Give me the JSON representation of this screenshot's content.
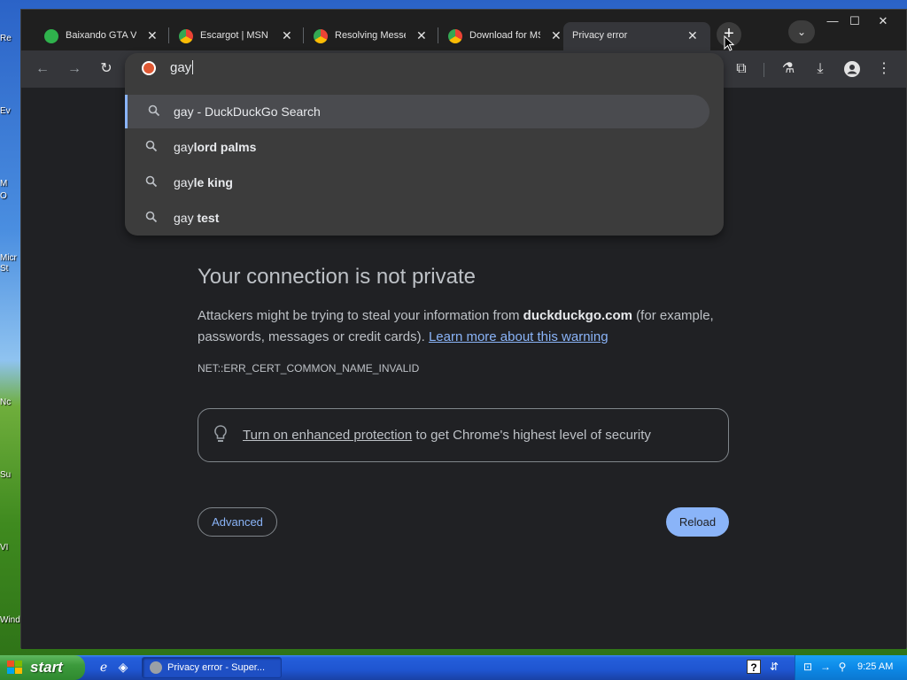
{
  "desktop": {
    "icon_labels": [
      "Re",
      "Ev",
      "M",
      "O",
      "Micr",
      "St",
      "Nc",
      "Su",
      "VI",
      "Wind"
    ]
  },
  "tabs": [
    {
      "title": "Baixando GTA V",
      "favicon": "green-app-icon",
      "favicon_color": "#2fb24c"
    },
    {
      "title": "Escargot | MSN M",
      "favicon": "chrome-icon",
      "favicon_color": "#f4b400"
    },
    {
      "title": "Resolving Messe",
      "favicon": "chrome-icon",
      "favicon_color": "#f4b400"
    },
    {
      "title": "Download for MS",
      "favicon": "chrome-icon",
      "favicon_color": "#f4b400"
    },
    {
      "title": "Privacy error",
      "favicon": "none",
      "active": true
    }
  ],
  "omnibox": {
    "typed": "gay",
    "suggestions": [
      {
        "prefix": "gay",
        "suffix": " - DuckDuckGo Search",
        "bold": false,
        "selected": true
      },
      {
        "prefix": "gay",
        "suffix": "lord palms",
        "bold": true,
        "selected": false
      },
      {
        "prefix": "gay",
        "suffix": "le king",
        "bold": true,
        "selected": false
      },
      {
        "prefix": "gay ",
        "suffix": "test",
        "bold": true,
        "selected": false
      }
    ]
  },
  "error_page": {
    "title": "Your connection is not private",
    "body_pre": "Attackers might be trying to steal your information from ",
    "domain": "duckduckgo.com",
    "body_post": " (for example, passwords, messages or credit cards). ",
    "learn_more": "Learn more about this warning",
    "error_code": "NET::ERR_CERT_COMMON_NAME_INVALID",
    "enhanced_link": "Turn on enhanced protection",
    "enhanced_rest": " to get Chrome's highest level of security",
    "advanced_label": "Advanced",
    "reload_label": "Reload"
  },
  "taskbar": {
    "start_label": "start",
    "task_button": "Privacy error - Super...",
    "clock": "9:25 AM"
  },
  "colors": {
    "accent": "#8ab4f8",
    "page_bg": "#202124",
    "toolbar_bg": "#35363a"
  }
}
